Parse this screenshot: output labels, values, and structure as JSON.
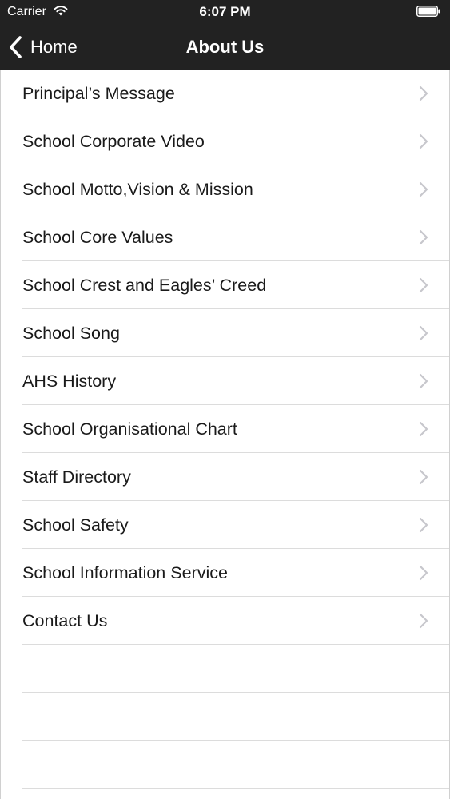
{
  "status_bar": {
    "carrier": "Carrier",
    "time": "6:07 PM",
    "wifi_icon": "wifi-icon",
    "battery_icon": "battery-icon"
  },
  "nav": {
    "back_label": "Home",
    "back_icon": "chevron-left-icon",
    "title": "About Us",
    "background_color": "#222222"
  },
  "list": {
    "items": [
      {
        "label": "Principal’s Message"
      },
      {
        "label": "School Corporate Video"
      },
      {
        "label": "School Motto,Vision & Mission"
      },
      {
        "label": "School Core Values"
      },
      {
        "label": "School Crest and Eagles’ Creed"
      },
      {
        "label": "School Song"
      },
      {
        "label": "AHS History"
      },
      {
        "label": "School Organisational Chart"
      },
      {
        "label": "Staff Directory"
      },
      {
        "label": "School Safety"
      },
      {
        "label": "School Information Service"
      },
      {
        "label": "Contact Us"
      }
    ],
    "chevron_icon": "chevron-right-icon"
  }
}
